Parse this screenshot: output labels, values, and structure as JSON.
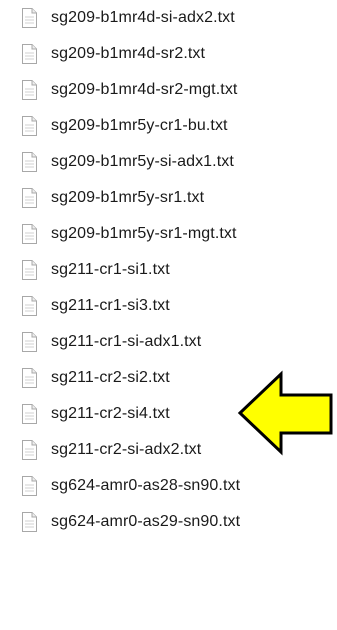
{
  "files": [
    {
      "name": "sg209-b1mr4d-si-adx2.txt"
    },
    {
      "name": "sg209-b1mr4d-sr2.txt"
    },
    {
      "name": "sg209-b1mr4d-sr2-mgt.txt"
    },
    {
      "name": "sg209-b1mr5y-cr1-bu.txt"
    },
    {
      "name": "sg209-b1mr5y-si-adx1.txt"
    },
    {
      "name": "sg209-b1mr5y-sr1.txt"
    },
    {
      "name": "sg209-b1mr5y-sr1-mgt.txt"
    },
    {
      "name": "sg211-cr1-si1.txt"
    },
    {
      "name": "sg211-cr1-si3.txt"
    },
    {
      "name": "sg211-cr1-si-adx1.txt"
    },
    {
      "name": "sg211-cr2-si2.txt"
    },
    {
      "name": "sg211-cr2-si4.txt"
    },
    {
      "name": "sg211-cr2-si-adx2.txt"
    },
    {
      "name": "sg624-amr0-as28-sn90.txt"
    },
    {
      "name": "sg624-amr0-as29-sn90.txt"
    }
  ],
  "icons": {
    "file": "text-file-icon",
    "pointer": "yellow-arrow-icon"
  },
  "colors": {
    "arrow_fill": "#ffff00",
    "arrow_stroke": "#000000",
    "text": "#1a1a1a"
  }
}
